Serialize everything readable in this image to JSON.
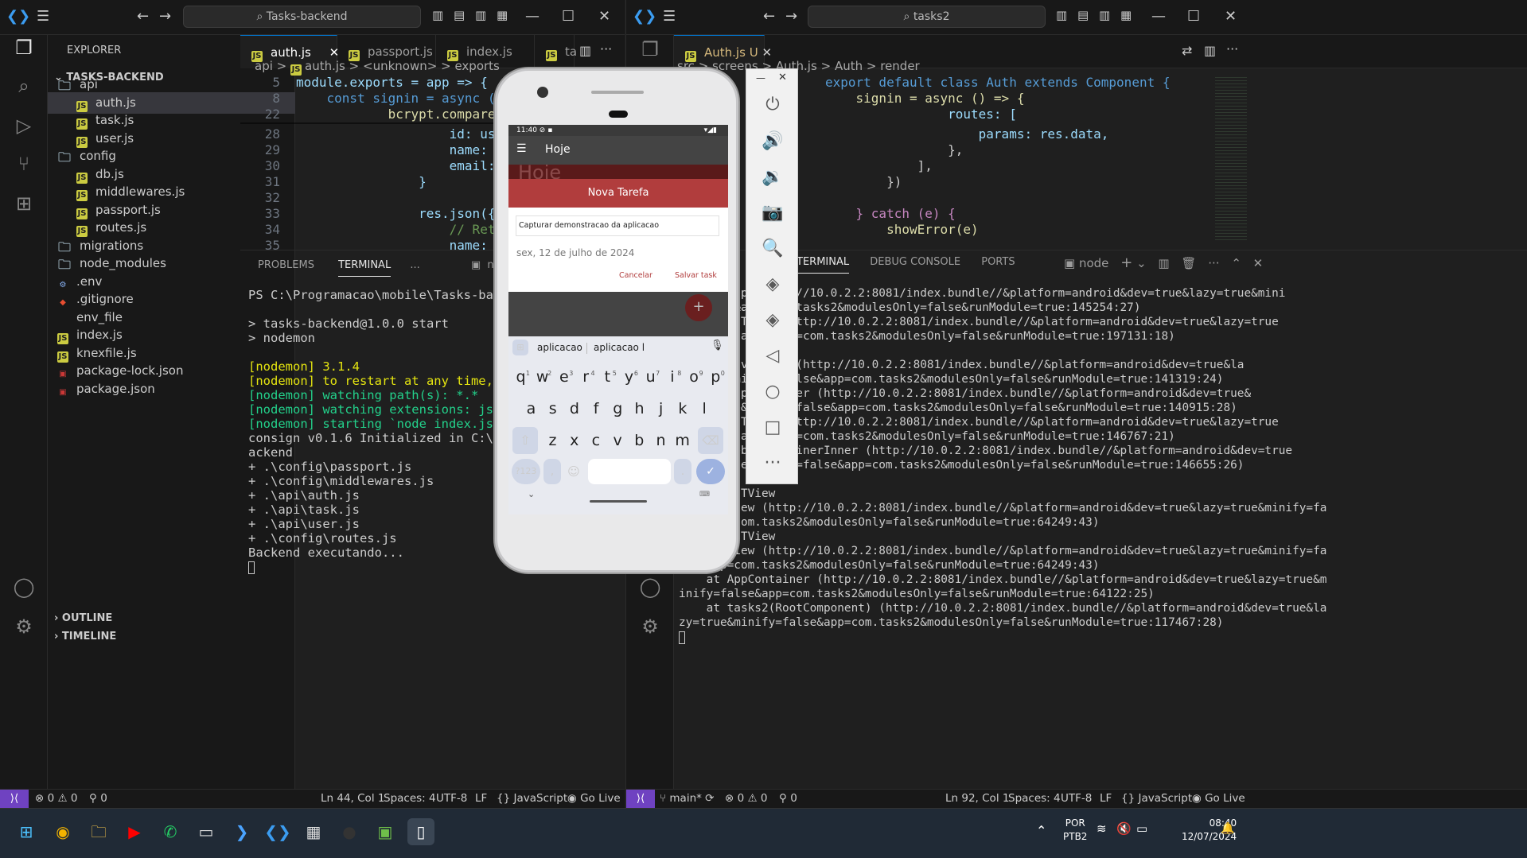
{
  "left_window": {
    "search": "Tasks-backend",
    "explorer_title": "EXPLORER",
    "root": "TASKS-BACKEND",
    "tree": [
      {
        "label": "api",
        "type": "folder"
      },
      {
        "label": "auth.js",
        "type": "js"
      },
      {
        "label": "task.js",
        "type": "js"
      },
      {
        "label": "user.js",
        "type": "js"
      },
      {
        "label": "config",
        "type": "folder"
      },
      {
        "label": "db.js",
        "type": "js"
      },
      {
        "label": "middlewares.js",
        "type": "js"
      },
      {
        "label": "passport.js",
        "type": "js"
      },
      {
        "label": "routes.js",
        "type": "js"
      },
      {
        "label": "migrations",
        "type": "folder"
      },
      {
        "label": "node_modules",
        "type": "folder"
      },
      {
        "label": ".env",
        "type": "env"
      },
      {
        "label": ".gitignore",
        "type": "git"
      },
      {
        "label": "env_file",
        "type": "plain"
      },
      {
        "label": "index.js",
        "type": "js"
      },
      {
        "label": "knexfile.js",
        "type": "js"
      },
      {
        "label": "package-lock.json",
        "type": "npm"
      },
      {
        "label": "package.json",
        "type": "npm"
      }
    ],
    "outline": "OUTLINE",
    "timeline": "TIMELINE",
    "tabs": [
      "auth.js",
      "passport.js",
      "index.js",
      "ta"
    ],
    "breadcrumb": [
      "api",
      ">",
      "auth.js",
      ">",
      "<unknown>",
      ">",
      "exports"
    ],
    "code_lines": [
      {
        "n": "5",
        "t": "module.exports = app => {"
      },
      {
        "n": "8",
        "t": "    const signin = async (req, r"
      },
      {
        "n": "22",
        "t": "            bcrypt.compare(req.b"
      },
      {
        "n": "28",
        "t": "                    id: user.id,"
      },
      {
        "n": "29",
        "t": "                    name: user.n"
      },
      {
        "n": "30",
        "t": "                    email: user."
      },
      {
        "n": "31",
        "t": "                }"
      },
      {
        "n": "32",
        "t": ""
      },
      {
        "n": "33",
        "t": "                res.json({"
      },
      {
        "n": "34",
        "t": "                    // Retorno p"
      },
      {
        "n": "35",
        "t": "                    name: user.n"
      }
    ],
    "panel_tabs": [
      "PROBLEMS",
      "TERMINAL",
      "..."
    ],
    "terminal_shell": "node",
    "terminal": [
      "PS C:\\Programacao\\mobile\\Tasks-backend> n",
      "",
      "> tasks-backend@1.0.0 start",
      "> nodemon",
      "",
      "[nodemon] 3.1.4",
      "[nodemon] to restart at any time, enter `",
      "[nodemon] watching path(s): *.*",
      "[nodemon] watching extensions: js,mjs,cjs",
      "[nodemon] starting `node index.js`",
      "consign v0.1.6 Initialized in C:\\Programa",
      "ackend",
      "+ .\\config\\passport.js",
      "+ .\\config\\middlewares.js",
      "+ .\\api\\auth.js",
      "+ .\\api\\task.js",
      "+ .\\api\\user.js",
      "+ .\\config\\routes.js",
      "Backend executando..."
    ],
    "status": {
      "errors": "0",
      "warnings": "0",
      "ports": "0",
      "pos": "Ln 44, Col 1",
      "spaces": "Spaces: 4",
      "enc": "UTF-8",
      "eol": "LF",
      "lang": "JavaScript",
      "golive": "Go Live"
    }
  },
  "right_window": {
    "search": "tasks2",
    "tab": "Auth.js",
    "tab_badge": "U",
    "breadcrumb": [
      "src",
      ">",
      "screens",
      ">",
      "Auth.js",
      ">",
      "Auth",
      ">",
      "render"
    ],
    "code_lines": [
      "export default class Auth extends Component {",
      "    signin = async () => {",
      "                routes: [",
      "                    params: res.data,",
      "                },",
      "            ],",
      "        })",
      "",
      "    } catch (e) {",
      "        showError(e)"
    ],
    "panel_tabs": [
      "TERMINAL",
      "DEBUG CONSOLE",
      "PORTS"
    ],
    "terminal_shell": "node",
    "terminal": [
      "    at App (http://10.0.2.2:8081/index.bundle//&platform=android&dev=true&lazy=true&mini",
      "fy=false&app=com.tasks2&modulesOnly=false&runModule=true:145254:27)",
      "    at RCTView (http://10.0.2.2:8081/index.bundle//&platform=android&dev=true&lazy=true",
      "&minify=false&app=com.tasks2&modulesOnly=false&runModule=true:197131:18)",
      "",
      "    at Navigator (http://10.0.2.2:8081/index.bundle//&platform=android&dev=true&la",
      "zy=true&minify=false&app=com.tasks2&modulesOnly=false&runModule=true:141319:24)",
      "    at AppContainer (http://10.0.2.2:8081/index.bundle//&platform=android&dev=true&",
      "lazy=true&minify=false&app=com.tasks2&modulesOnly=false&runModule=true:140915:28)",
      "    at RCTView (http://10.0.2.2:8081/index.bundle//&platform=android&dev=true&lazy=true",
      "&minify=false&app=com.tasks2&modulesOnly=false&runModule=true:146767:21)",
      "    at DebugContainerInner (http://10.0.2.2:8081/index.bundle//&platform=android&dev=true",
      "&lazy=true&minify=false&app=com.tasks2&modulesOnly=false&runModule=true:146655:26)",
      "",
      "    at RCTView",
      "    at View (http://10.0.2.2:8081/index.bundle//&platform=android&dev=true&lazy=true&minify=fa",
      "lse&app=com.tasks2&modulesOnly=false&runModule=true:64249:43)",
      "    at RCTView",
      "    at View (http://10.0.2.2:8081/index.bundle//&platform=android&dev=true&lazy=true&minify=fa",
      "lse&app=com.tasks2&modulesOnly=false&runModule=true:64249:43)",
      "    at AppContainer (http://10.0.2.2:8081/index.bundle//&platform=android&dev=true&lazy=true&m",
      "inify=false&app=com.tasks2&modulesOnly=false&runModule=true:64122:25)",
      "    at tasks2(RootComponent) (http://10.0.2.2:8081/index.bundle//&platform=android&dev=true&la",
      "zy=true&minify=false&app=com.tasks2&modulesOnly=false&runModule=true:117467:28)"
    ],
    "status": {
      "branch": "main*",
      "errors": "0",
      "warnings": "0",
      "ports": "0",
      "pos": "Ln 92, Col 1",
      "spaces": "Spaces: 4",
      "enc": "UTF-8",
      "eol": "LF",
      "lang": "JavaScript",
      "golive": "Go Live"
    }
  },
  "phone": {
    "time": "11:40",
    "app_title": "Hoje",
    "bg_title": "Hoje",
    "modal_title": "Nova Tarefa",
    "input_value": "Capturar demonstracao da aplicacao",
    "date": "sex, 12 de julho de 2024",
    "cancel": "Cancelar",
    "save": "Salvar task",
    "fab": "+",
    "suggestions": [
      "aplicacao",
      "aplicacao l"
    ],
    "row1": [
      "q",
      "w",
      "e",
      "r",
      "t",
      "y",
      "u",
      "i",
      "o",
      "p"
    ],
    "row1_hints": [
      "1",
      "2",
      "3",
      "4",
      "5",
      "6",
      "7",
      "8",
      "9",
      "0"
    ],
    "row2": [
      "a",
      "s",
      "d",
      "f",
      "g",
      "h",
      "j",
      "k",
      "l"
    ],
    "row3": [
      "z",
      "x",
      "c",
      "v",
      "b",
      "n",
      "m"
    ],
    "sym": "?123",
    "comma": ",",
    "period": "."
  },
  "taskbar": {
    "lang": "POR",
    "layout": "PTB2",
    "time": "08:40",
    "date": "12/07/2024"
  }
}
